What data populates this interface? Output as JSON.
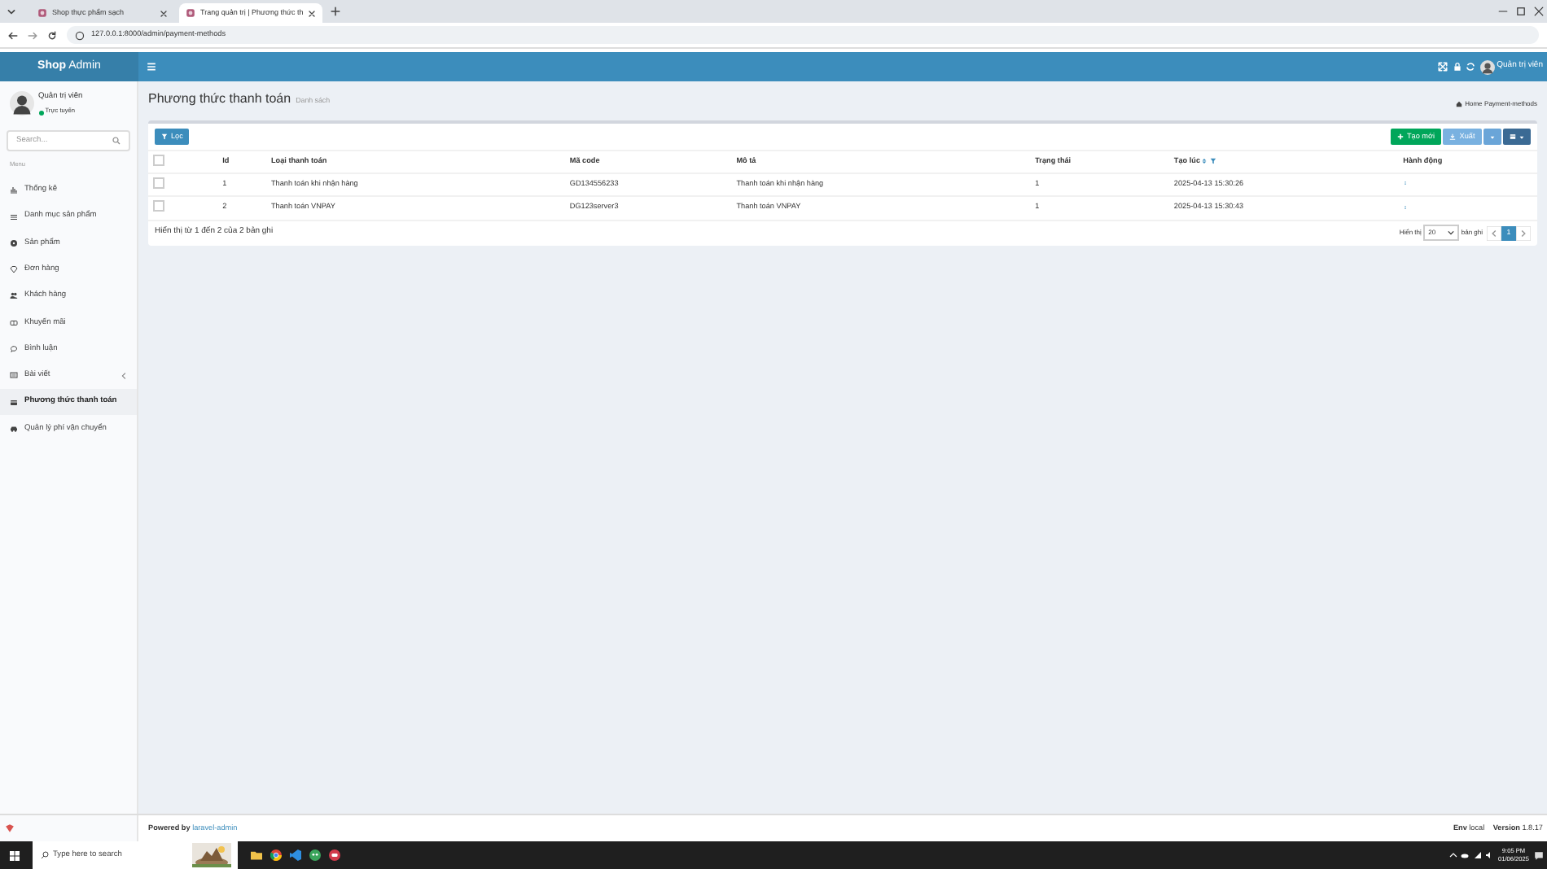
{
  "browser": {
    "tabs": [
      {
        "title": "Shop thực phẩm sạch",
        "selected": false
      },
      {
        "title": "Trang quản trị | Phương thức th",
        "selected": true
      }
    ],
    "url": "127.0.0.1:8000/admin/payment-methods"
  },
  "header": {
    "brand_bold": "Shop",
    "brand_light": "Admin",
    "user_name": "Quản trị viên"
  },
  "sidebar": {
    "user_name": "Quản trị viên",
    "user_status": "Trực tuyến",
    "search_placeholder": "Search...",
    "menu_heading": "Menu",
    "items": [
      {
        "label": "Thống kê",
        "selected": false,
        "has_submenu": false
      },
      {
        "label": "Danh mục sản phẩm",
        "selected": false,
        "has_submenu": false
      },
      {
        "label": "Sản phẩm",
        "selected": false,
        "has_submenu": false
      },
      {
        "label": "Đơn hàng",
        "selected": false,
        "has_submenu": false
      },
      {
        "label": "Khách hàng",
        "selected": false,
        "has_submenu": false
      },
      {
        "label": "Khuyến mãi",
        "selected": false,
        "has_submenu": false
      },
      {
        "label": "Bình luận",
        "selected": false,
        "has_submenu": false
      },
      {
        "label": "Bài viết",
        "selected": false,
        "has_submenu": true
      },
      {
        "label": "Phương thức thanh toán",
        "selected": true,
        "has_submenu": false
      },
      {
        "label": "Quản lý phí vận chuyển",
        "selected": false,
        "has_submenu": false
      }
    ]
  },
  "content": {
    "title": "Phương thức thanh toán",
    "subtitle": "Danh sách",
    "breadcrumb": [
      "Home",
      "Payment-methods"
    ],
    "filter_button": "Lọc",
    "create_button": "Tạo mới",
    "export_button": "Xuất",
    "table": {
      "select_all_checked": false,
      "columns": [
        {
          "label": "Id"
        },
        {
          "label": "Loại thanh toán"
        },
        {
          "label": "Mã code"
        },
        {
          "label": "Mô tả"
        },
        {
          "label": "Trạng thái"
        },
        {
          "label": "Tạo lúc",
          "sortable": true,
          "filterable": true
        },
        {
          "label": "Hành động"
        }
      ],
      "rows": [
        {
          "checked": false,
          "cells": [
            "1",
            "Thanh toán khi nhận hàng",
            "GD134556233",
            "Thanh toán khi nhận hàng",
            "1",
            "2025-04-13 15:30:26"
          ]
        },
        {
          "checked": false,
          "cells": [
            "2",
            "Thanh toán VNPAY",
            "DG123server3",
            "Thanh toán VNPAY",
            "1",
            "2025-04-13 15:30:43"
          ]
        }
      ]
    },
    "summary": "Hiển thị từ 1 đến 2 của 2 bản ghi",
    "per_page_label": "Hiển thị",
    "per_page": "20",
    "per_page_suffix": "bản ghi",
    "pages": [
      {
        "label": "1",
        "selected": true
      }
    ]
  },
  "footer": {
    "powered_by": "Powered by",
    "link": "laravel-admin",
    "env_label": "Env",
    "env": "local",
    "version_label": "Version",
    "version": "1.8.17"
  },
  "taskbar": {
    "search_placeholder": "Type here to search",
    "time": "9:05 PM",
    "date": "01/06/2025"
  }
}
